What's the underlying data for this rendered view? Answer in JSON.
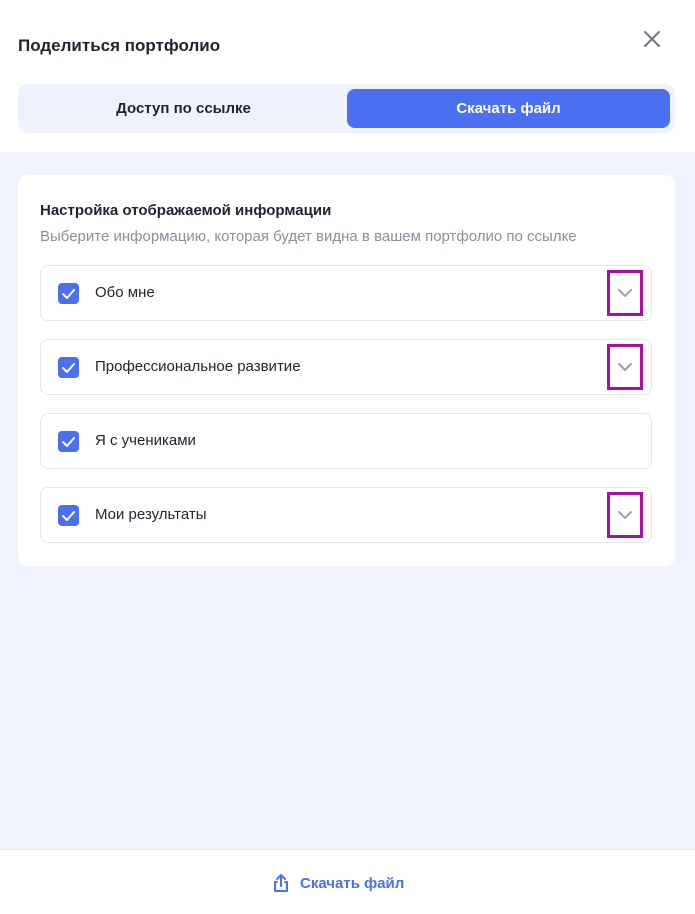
{
  "dialog": {
    "title": "Поделиться портфолио"
  },
  "tabs": {
    "link_access": "Доступ по ссылке",
    "download_file": "Скачать файл",
    "active": "download_file"
  },
  "settings": {
    "title": "Настройка отображаемой информации",
    "subtitle": "Выберите информацию, которая будет видна в вашем портфолио по ссылке",
    "items": [
      {
        "label": "Обо мне",
        "checked": true,
        "expandable": true
      },
      {
        "label": "Профессиональное развитие",
        "checked": true,
        "expandable": true
      },
      {
        "label": "Я с учениками",
        "checked": true,
        "expandable": false
      },
      {
        "label": "Мои результаты",
        "checked": true,
        "expandable": true
      }
    ]
  },
  "footer": {
    "download_label": "Скачать файл"
  },
  "colors": {
    "accent": "#4a6ff0",
    "highlight_border": "#a8119e",
    "background": "#f0f3fd"
  },
  "icons": {
    "close": "close-icon",
    "check": "check-icon",
    "chevron": "chevron-down-icon",
    "share": "share-upload-icon"
  }
}
